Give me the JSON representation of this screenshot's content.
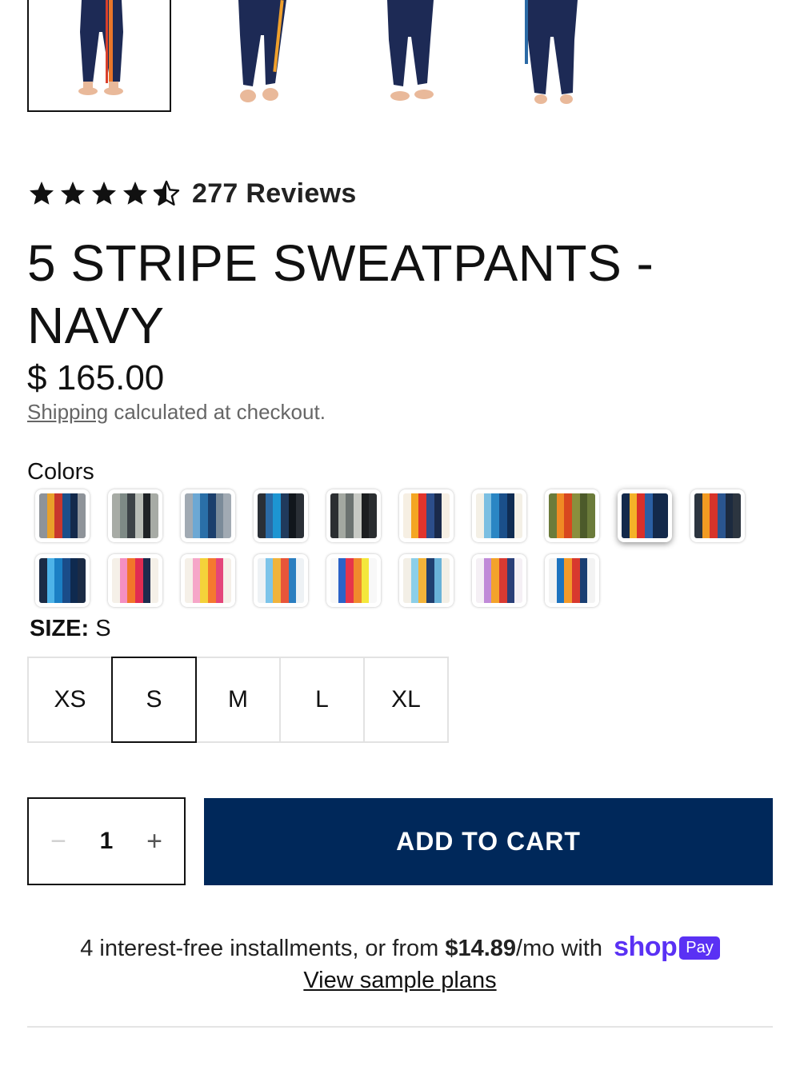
{
  "gallery": {
    "thumbnails": [
      {
        "alt": "front view"
      },
      {
        "alt": "side view"
      },
      {
        "alt": "front view 2"
      },
      {
        "alt": "back view"
      }
    ]
  },
  "rating": {
    "value": 4.5,
    "max": 5,
    "reviews_text": "277 Reviews"
  },
  "product": {
    "title": "5 STRIPE SWEATPANTS - NAVY",
    "price": "$ 165.00",
    "shipping_link": "Shipping",
    "shipping_rest": " calculated at checkout."
  },
  "colors": {
    "label": "Colors",
    "swatches": [
      {
        "stripes": [
          "#8e9399",
          "#e9a12a",
          "#c8372d",
          "#1b4f8a",
          "#13294b",
          "#8e9399"
        ]
      },
      {
        "stripes": [
          "#a7aba5",
          "#7e8a86",
          "#3c4247",
          "#b9bdb7",
          "#1f2326",
          "#a7aba5"
        ]
      },
      {
        "stripes": [
          "#a1aab3",
          "#6ca8d4",
          "#2a6fa8",
          "#1b3f6c",
          "#7b8b99",
          "#a1aab3"
        ]
      },
      {
        "stripes": [
          "#2a2f36",
          "#2b6aa5",
          "#1d95d2",
          "#203a5c",
          "#11161c",
          "#2a2f36"
        ]
      },
      {
        "stripes": [
          "#2b2e31",
          "#a3a8a1",
          "#6b7270",
          "#c7c9c4",
          "#1c1e20",
          "#2b2e31"
        ]
      },
      {
        "stripes": [
          "#f6efe3",
          "#f4a623",
          "#e0342c",
          "#2c4e8a",
          "#1a2a4a",
          "#f6efe3"
        ]
      },
      {
        "stripes": [
          "#f4f0e6",
          "#7bbfe2",
          "#2a86c4",
          "#1a4f8a",
          "#0f2c52",
          "#f4f0e6"
        ]
      },
      {
        "stripes": [
          "#6b7b3a",
          "#f08a24",
          "#d8471f",
          "#8a8f3d",
          "#4c5a2a",
          "#6b7b3a"
        ]
      },
      {
        "stripes": [
          "#13294b",
          "#f4b228",
          "#d9302a",
          "#2a5fa4",
          "#13294b",
          "#13294b"
        ]
      },
      {
        "stripes": [
          "#2c3540",
          "#f29b22",
          "#d7342a",
          "#2a5590",
          "#1c2a3f",
          "#2c3540"
        ]
      },
      {
        "stripes": [
          "#1b2b45",
          "#4db3e8",
          "#1b7fc4",
          "#1a4c89",
          "#0f2a4f",
          "#1b2b45"
        ]
      },
      {
        "stripes": [
          "#f5f0e8",
          "#f48fc1",
          "#f2762a",
          "#e12c52",
          "#1e2b4d",
          "#f5f0e8"
        ]
      },
      {
        "stripes": [
          "#f5f0e8",
          "#f6a6c8",
          "#f4d23a",
          "#f5792f",
          "#e4457a",
          "#f5f0e8"
        ]
      },
      {
        "stripes": [
          "#eef2f5",
          "#7cc4ea",
          "#f0b33b",
          "#e8553a",
          "#2a7ec0",
          "#eef2f5"
        ]
      },
      {
        "stripes": [
          "#f8f8f8",
          "#2a63c8",
          "#e6354a",
          "#f08a2c",
          "#f4e83c",
          "#f8f8f8"
        ]
      },
      {
        "stripes": [
          "#f3efe6",
          "#8ccfe8",
          "#f3b43a",
          "#1f3f70",
          "#69b2d8",
          "#f3efe6"
        ]
      },
      {
        "stripes": [
          "#f5f0f5",
          "#c08ad8",
          "#f3a32a",
          "#d93a32",
          "#2a3f78",
          "#f5f0f5"
        ]
      },
      {
        "stripes": [
          "#f3f3f3",
          "#1d73bf",
          "#f39a2a",
          "#d8392e",
          "#1a3f73",
          "#f3f3f3"
        ]
      }
    ],
    "selected_index": 8
  },
  "size": {
    "label": "SIZE:",
    "selected": "S",
    "options": [
      "XS",
      "S",
      "M",
      "L",
      "XL"
    ]
  },
  "cart": {
    "quantity": "1",
    "minus_glyph": "−",
    "plus_glyph": "+",
    "add_label": "ADD TO CART"
  },
  "installments": {
    "prefix": "4 interest-free installments, or from ",
    "amount": "$14.89",
    "suffix": "/mo with ",
    "brand": "shop",
    "badge": "Pay",
    "link": "View sample plans"
  },
  "theme": {
    "primary": "#00285a",
    "shop_pay": "#5a31f4"
  }
}
